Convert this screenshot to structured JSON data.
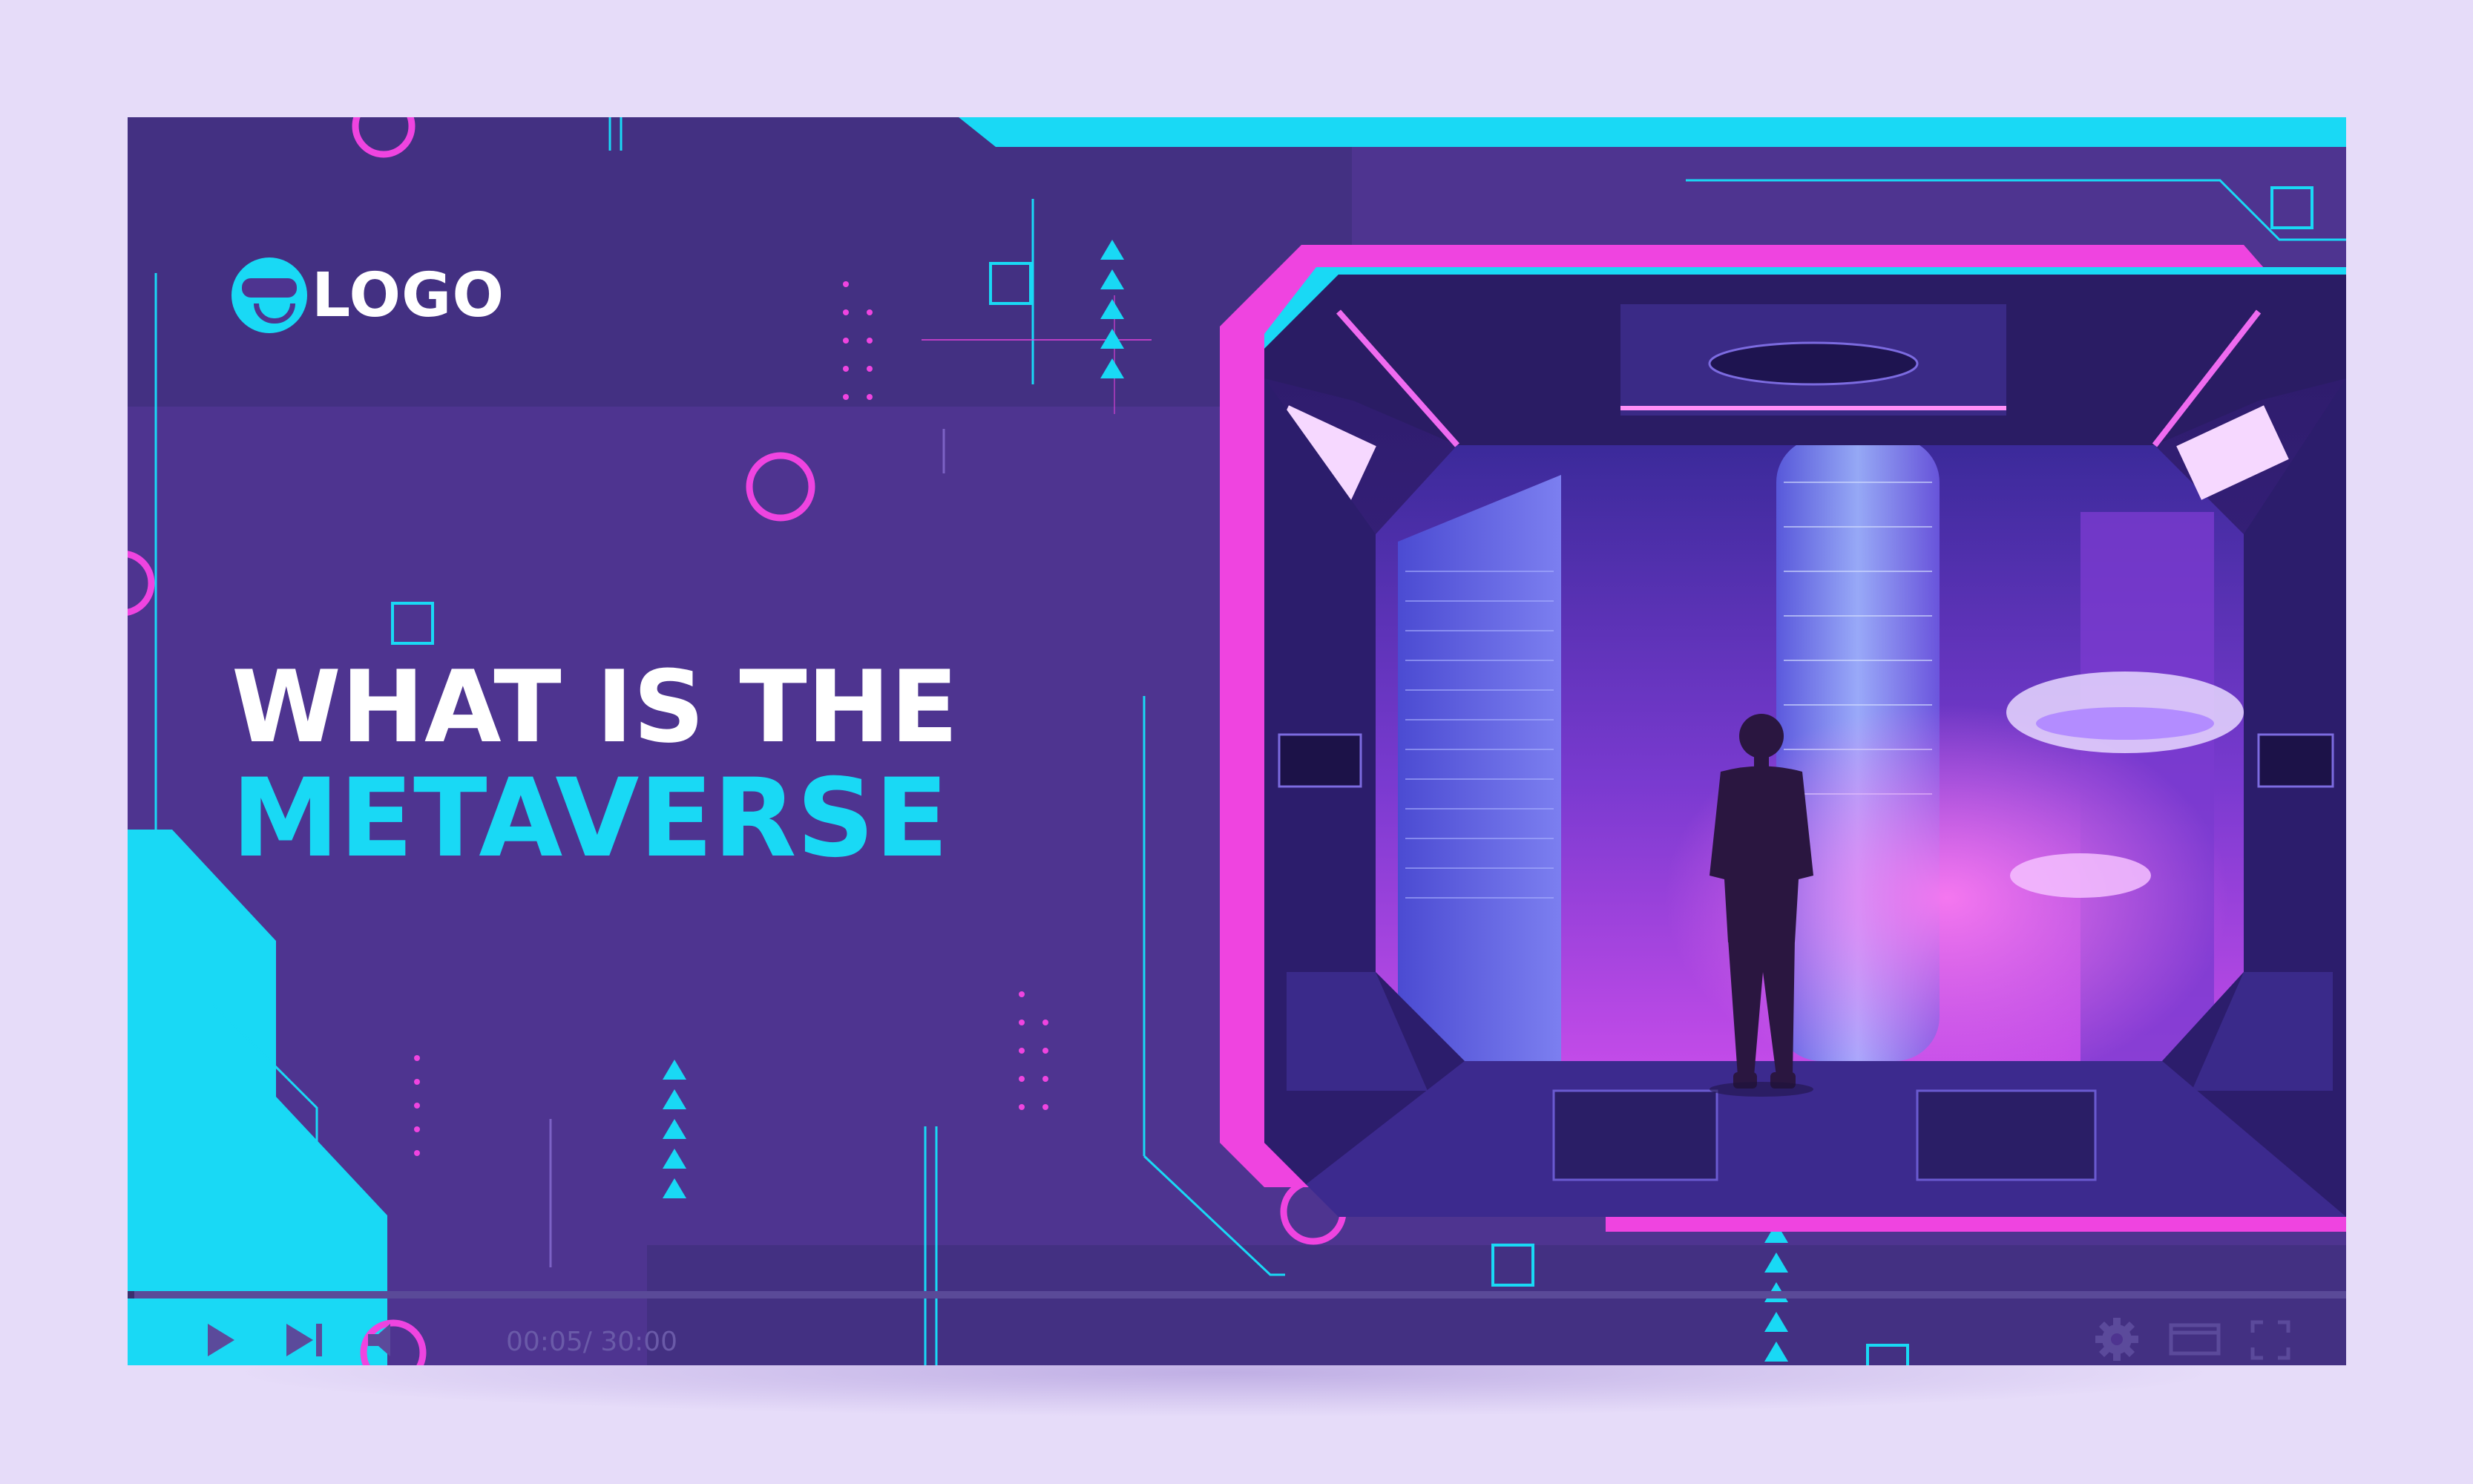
{
  "logo": {
    "text": "LOGO",
    "icon": "vr-face-icon"
  },
  "headline": {
    "line1": "WHAT IS THE",
    "line2": "METAVERSE"
  },
  "player": {
    "current_time": "00:05",
    "total_time": "/ 30:00",
    "progress": 0.003,
    "icons": [
      "play-icon",
      "skip-next-icon",
      "volume-icon",
      "settings-icon",
      "theater-mode-icon",
      "fullscreen-icon"
    ]
  },
  "colors": {
    "background": "#e6dcf9",
    "card": "#4e3490",
    "cyan": "#19d9f5",
    "magenta": "#ef44e0",
    "text": "#ffffff"
  }
}
